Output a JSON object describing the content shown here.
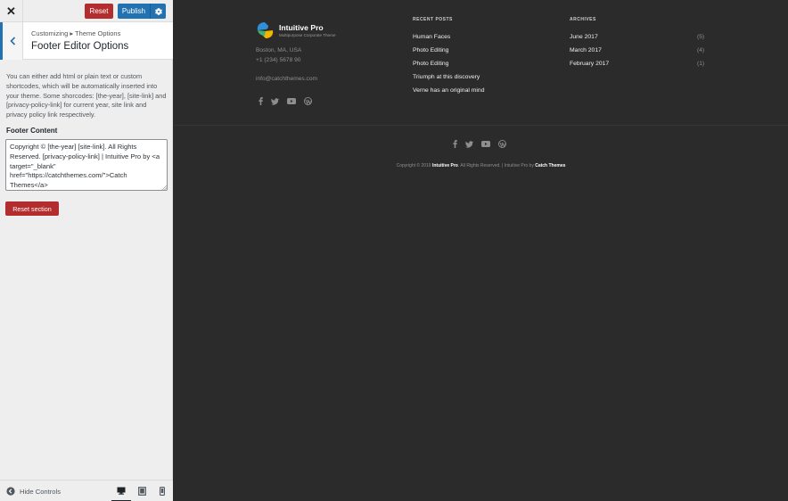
{
  "toolbar": {
    "close_icon": "close-icon",
    "reset_label": "Reset",
    "publish_label": "Publish",
    "settings_icon": "gear-icon"
  },
  "section": {
    "breadcrumb": "Customizing ▸ Theme Options",
    "title": "Footer Editor Options",
    "back_icon": "chevron-left-icon"
  },
  "description": "You can either add html or plain text or custom shortcodes, which will be automatically inserted into your theme. Some shorcodes: [the-year], [site-link] and [privacy-policy-link] for current year, site link and privacy policy link respectively.",
  "footer_field": {
    "label": "Footer Content",
    "value": "Copyright © [the-year] [site-link]. All Rights Reserved. [privacy-policy-link] | Intuitive Pro by <a target=\"_blank\" href=\"https://catchthemes.com/\">Catch Themes</a>"
  },
  "reset_section_label": "Reset section",
  "bottombar": {
    "hide_controls_label": "Hide Controls",
    "devices": [
      "desktop-icon",
      "tablet-icon",
      "mobile-icon"
    ]
  },
  "preview": {
    "site_name": "Intuitive Pro",
    "tagline": "Multipurpose Corporate Theme",
    "address": "Boston, MA, USA",
    "phone": "+1 (234) 5678 90",
    "email": "info@catchthemes.com",
    "social_icons": [
      "facebook-icon",
      "twitter-icon",
      "youtube-icon",
      "wordpress-icon"
    ],
    "recent_posts": {
      "title": "RECENT POSTS",
      "items": [
        "Human Faces",
        "Photo Editing",
        "Photo Editing",
        "Triumph at this discovery",
        "Verne has an original mind"
      ]
    },
    "archives": {
      "title": "ARCHIVES",
      "items": [
        {
          "label": "June 2017",
          "count": "(5)"
        },
        {
          "label": "March 2017",
          "count": "(4)"
        },
        {
          "label": "February 2017",
          "count": "(1)"
        }
      ]
    },
    "copyright": {
      "prefix": "Copyright © 2019 ",
      "site": "Intuitive Pro",
      "middle": ". All Rights Reserved. | Intuitive Pro by ",
      "author": "Catch Themes"
    }
  },
  "colors": {
    "accent": "#2271b1",
    "danger": "#b32d2e",
    "preview_bg": "#2b2b2b"
  }
}
